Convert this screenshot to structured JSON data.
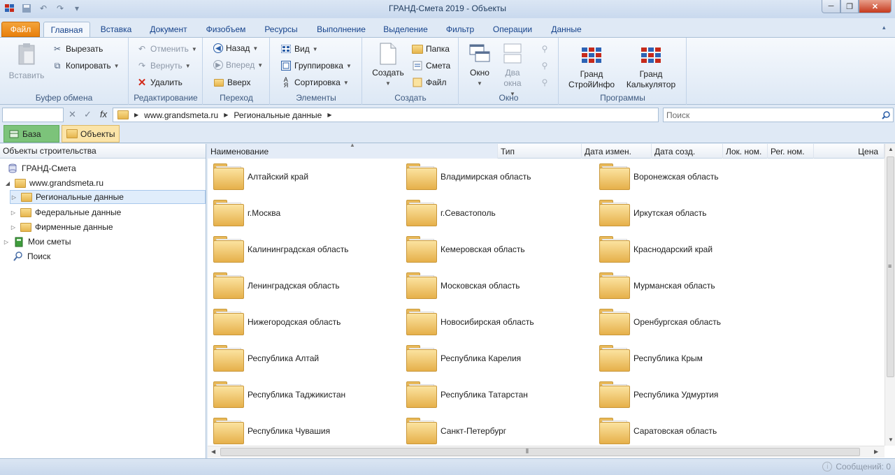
{
  "window": {
    "title": "ГРАНД-Смета 2019 - Объекты",
    "min_glyph": "─",
    "max_glyph": "❐",
    "close_glyph": "✕"
  },
  "qat": {
    "icons": [
      "app-logo-icon",
      "save-icon",
      "undo-icon",
      "redo-icon",
      "customize-icon"
    ]
  },
  "ribbon_tabs": [
    {
      "label": "Файл"
    },
    {
      "label": "Главная"
    },
    {
      "label": "Вставка"
    },
    {
      "label": "Документ"
    },
    {
      "label": "Физобъем"
    },
    {
      "label": "Ресурсы"
    },
    {
      "label": "Выполнение"
    },
    {
      "label": "Выделение"
    },
    {
      "label": "Фильтр"
    },
    {
      "label": "Операции"
    },
    {
      "label": "Данные"
    }
  ],
  "ribbon": {
    "clipboard": {
      "label": "Буфер обмена",
      "paste": "Вставить",
      "cut": "Вырезать",
      "copy": "Копировать"
    },
    "editing": {
      "label": "Редактирование",
      "undo": "Отменить",
      "redo": "Вернуть",
      "delete": "Удалить"
    },
    "navigation": {
      "label": "Переход",
      "back": "Назад",
      "forward": "Вперед",
      "up": "Вверх"
    },
    "elements": {
      "label": "Элементы",
      "view": "Вид",
      "group": "Группировка",
      "sort": "Сортировка"
    },
    "create": {
      "label": "Создать",
      "create": "Создать",
      "folder": "Папка",
      "estimate": "Смета",
      "file": "Файл"
    },
    "window": {
      "label": "Окно",
      "window": "Окно",
      "two_windows_1": "Два",
      "two_windows_2": "окна"
    },
    "programs": {
      "label": "Программы",
      "grand_info_1": "Гранд",
      "grand_info_2": "СтройИнфо",
      "grand_calc_1": "Гранд",
      "grand_calc_2": "Калькулятор"
    }
  },
  "address": {
    "cell_name": "",
    "fx": "fx",
    "crumbs": [
      "www.grandsmeta.ru",
      "Региональные данные"
    ],
    "search_placeholder": "Поиск"
  },
  "doc_tabs": [
    {
      "label": "База"
    },
    {
      "label": "Объекты"
    }
  ],
  "tree": {
    "header": "Объекты строительства",
    "nodes": [
      {
        "label": "ГРАНД-Смета"
      },
      {
        "label": "www.grandsmeta.ru"
      },
      {
        "label": "Региональные данные"
      },
      {
        "label": "Федеральные данные"
      },
      {
        "label": "Фирменные данные"
      },
      {
        "label": "Мои сметы"
      },
      {
        "label": "Поиск"
      }
    ]
  },
  "columns": [
    "Наименование",
    "Тип",
    "Дата измен.",
    "Дата созд.",
    "Лок. ном.",
    "Рег. ном.",
    "Цена"
  ],
  "items": [
    "Алтайский край",
    "Владимирская область",
    "Воронежская область",
    "г.Москва",
    "г.Севастополь",
    "Иркутская область",
    "Калининградская область",
    "Кемеровская область",
    "Краснодарский край",
    "Ленинградская область",
    "Московская область",
    "Мурманская область",
    "Нижегородская область",
    "Новосибирская область",
    "Оренбургская область",
    "Республика Алтай",
    "Республика Карелия",
    "Республика Крым",
    "Республика Таджикистан",
    "Республика Татарстан",
    "Республика Удмуртия",
    "Республика Чувашия",
    "Санкт-Петербург",
    "Саратовская область"
  ],
  "status": {
    "messages": "Сообщений: 0"
  },
  "colors": {
    "accent": "#15428b",
    "file_tab": "#e87f0b",
    "base_tab": "#7cc37a",
    "objects_tab": "#fbe4a8"
  }
}
